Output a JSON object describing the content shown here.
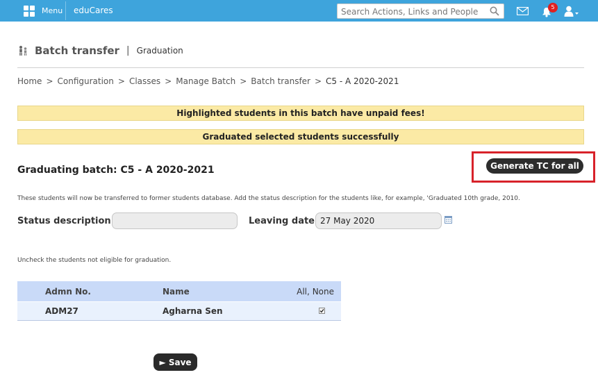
{
  "topbar": {
    "menu_label": "Menu",
    "brand": "eduCares",
    "search_placeholder": "Search Actions, Links and People",
    "notification_count": "5",
    "bar_color": "#3ea4dc",
    "badge_color": "#e02020"
  },
  "header": {
    "title": "Batch transfer",
    "separator": "|",
    "subtitle": "Graduation"
  },
  "breadcrumb": {
    "items": [
      "Home",
      "Configuration",
      "Classes",
      "Manage Batch",
      "Batch transfer"
    ],
    "separator": ">",
    "current": "C5 - A 2020-2021"
  },
  "notices": {
    "unpaid": "Highlighted students in this batch have unpaid fees!",
    "success": "Graduated selected students successfully",
    "color": "#fbeaa5"
  },
  "section": {
    "title": "Graduating batch: C5 - A 2020-2021",
    "generate_tc_label": "Generate TC for all",
    "highlight_color": "#d8222a",
    "description": "These students will now be transferred to former students database. Add the status description for the students like, for example, 'Graduated 10th grade, 2010.",
    "uncheck_hint": "Uncheck the students not eligible for graduation."
  },
  "form": {
    "status_label": "Status description :",
    "status_value": "",
    "leaving_label": "Leaving date:",
    "leaving_value": "27 May 2020"
  },
  "table": {
    "headers": {
      "admn": "Admn No.",
      "name": "Name",
      "all": "All",
      "comma": ",",
      "none": "None"
    },
    "rows": [
      {
        "admn": "ADM27",
        "name": "Agharna Sen",
        "checked": true
      }
    ]
  },
  "save_label": "Save",
  "save_icon": "play-triangle"
}
